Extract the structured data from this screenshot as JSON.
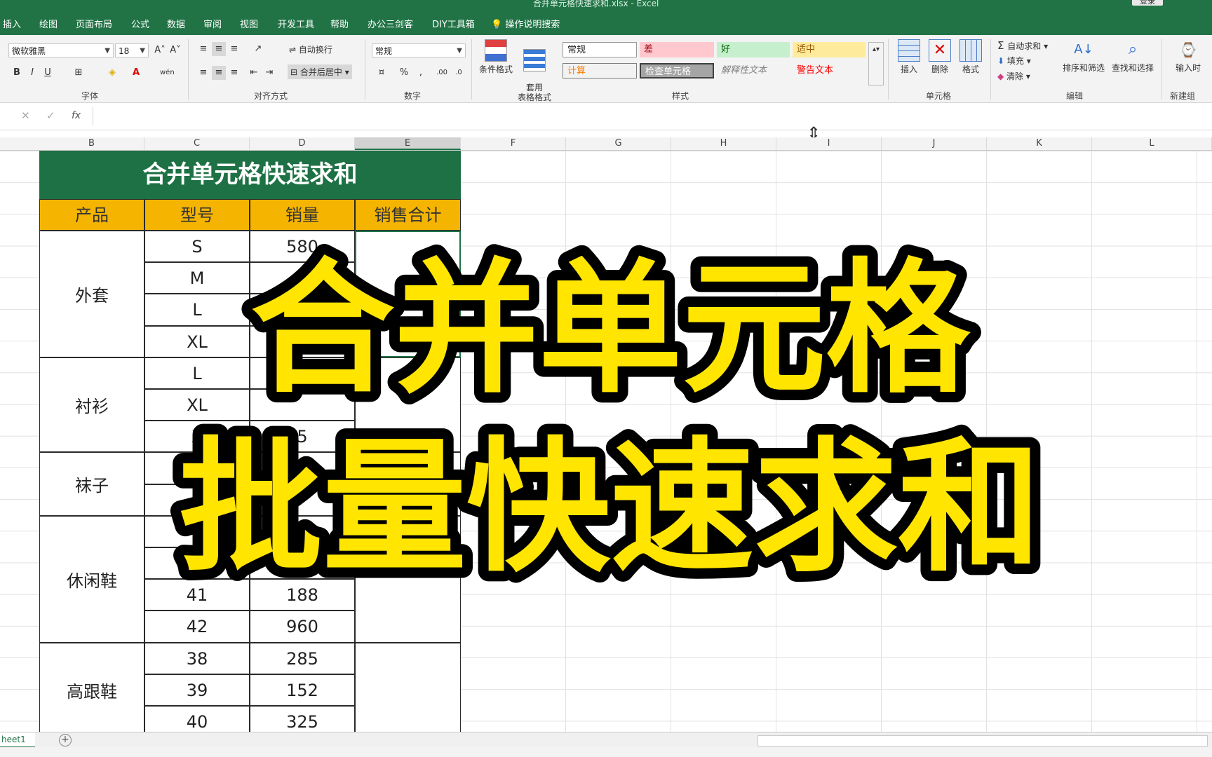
{
  "titlebar": {
    "document": "合并单元格快速求和.xlsx  -  Excel",
    "login": "登录"
  },
  "tabs": [
    "插入",
    "绘图",
    "页面布局",
    "公式",
    "数据",
    "审阅",
    "视图",
    "开发工具",
    "帮助",
    "办公三剑客",
    "DIY工具箱"
  ],
  "tab_search": "操作说明搜索",
  "ribbon": {
    "font_name": "微软雅黑",
    "font_size": "18",
    "wrap_text": "自动换行",
    "merge_center": "合并后居中",
    "number_format": "常规",
    "conditional_format": "条件格式",
    "table_format": "套用\n表格格式",
    "styles": {
      "normal": "常规",
      "bad": "差",
      "good": "好",
      "neutral": "适中",
      "calc": "计算",
      "check_cell": "检查单元格",
      "explanatory": "解释性文本",
      "warning": "警告文本"
    },
    "insert": "插入",
    "delete": "删除",
    "format": "格式",
    "autosum": "自动求和",
    "fill": "填充",
    "clear": "清除",
    "sort_filter": "排序和筛选",
    "find_select": "查找和选择",
    "input_time": "输入时",
    "groups": {
      "font": "字体",
      "alignment": "对齐方式",
      "number": "数字",
      "style": "样式",
      "cells": "单元格",
      "edit": "编辑",
      "new_group": "新建组"
    }
  },
  "formula_bar": {
    "fx": "fx"
  },
  "columns": [
    "B",
    "C",
    "D",
    "E",
    "F",
    "G",
    "H",
    "I",
    "J",
    "K",
    "L"
  ],
  "table": {
    "title": "合并单元格快速求和",
    "headers": [
      "产品",
      "型号",
      "销量",
      "销售合计"
    ],
    "groups": [
      {
        "product": "外套",
        "rows": [
          {
            "model": "S",
            "qty": "580"
          },
          {
            "model": "M",
            "qty": ""
          },
          {
            "model": "L",
            "qty": ""
          },
          {
            "model": "XL",
            "qty": ""
          }
        ]
      },
      {
        "product": "衬衫",
        "rows": [
          {
            "model": "L",
            "qty": ""
          },
          {
            "model": "XL",
            "qty": ""
          },
          {
            "model": "X",
            "qty": "5"
          }
        ]
      },
      {
        "product": "袜子",
        "rows": [
          {
            "model": "",
            "qty": "0"
          },
          {
            "model": "",
            "qty": ""
          }
        ]
      },
      {
        "product": "休闲鞋",
        "rows": [
          {
            "model": "",
            "qty": "5"
          },
          {
            "model": "",
            "qty": ""
          },
          {
            "model": "41",
            "qty": "188"
          },
          {
            "model": "42",
            "qty": "960"
          }
        ]
      },
      {
        "product": "高跟鞋",
        "rows": [
          {
            "model": "38",
            "qty": "285"
          },
          {
            "model": "39",
            "qty": "152"
          },
          {
            "model": "40",
            "qty": "325"
          }
        ]
      }
    ]
  },
  "overlay": {
    "line1": "合并单元格",
    "line2": "批量快速求和",
    "fill": "#ffe500",
    "stroke": "#000000"
  },
  "sheet": {
    "tab": "heet1",
    "add": "+"
  },
  "colors": {
    "excel_green": "#217346",
    "header_orange": "#f4b400",
    "title_green": "#1e7145"
  }
}
